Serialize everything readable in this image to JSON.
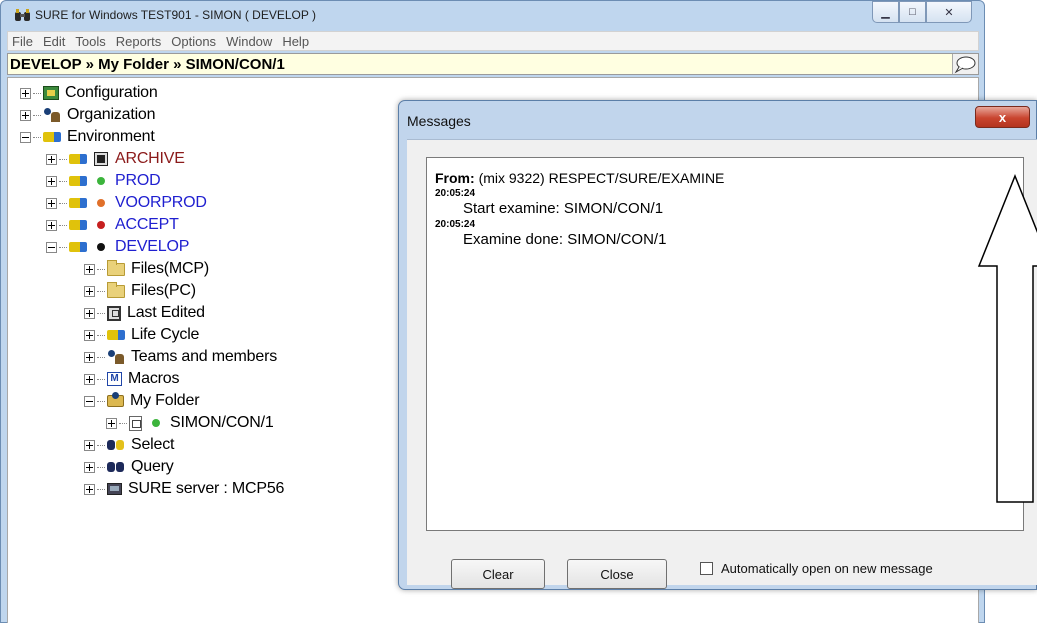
{
  "window": {
    "title": "SURE for Windows TEST901 - SIMON ( DEVELOP )",
    "minimize_symbol": "▁",
    "maximize_symbol": "□",
    "close_symbol": "✕"
  },
  "menu": [
    "File",
    "Edit",
    "Tools",
    "Reports",
    "Options",
    "Window",
    "Help"
  ],
  "path": "DEVELOP » My Folder » SIMON/CON/1",
  "tree": {
    "configuration": "Configuration",
    "organization": "Organization",
    "environment": "Environment",
    "archive": "ARCHIVE",
    "prod": "PROD",
    "voorprod": "VOORPROD",
    "accept": "ACCEPT",
    "develop": "DEVELOP",
    "files_mcp": "Files(MCP)",
    "files_pc": "Files(PC)",
    "last_edited": "Last Edited",
    "life_cycle": "Life Cycle",
    "teams": "Teams and members",
    "macros": "Macros",
    "my_folder": "My Folder",
    "simon_con": "SIMON/CON/1",
    "select": "Select",
    "query": "Query",
    "sure_server": "SURE server : MCP56"
  },
  "status_colors": {
    "prod": "#3cb43c",
    "voorprod": "#e0702a",
    "accept": "#c62020",
    "develop": "#111111",
    "simon_con": "#3cb43c"
  },
  "dialog": {
    "title": "Messages",
    "close_label": "x",
    "from_label": "From:",
    "from_value": "(mix 9322) RESPECT/SURE/EXAMINE",
    "time1": "20:05:24",
    "line1": "Start examine: SIMON/CON/1",
    "time2": "20:05:24",
    "line2": "Examine done: SIMON/CON/1",
    "clear_label": "Clear",
    "close_button_label": "Close",
    "auto_open_label": "Automatically open on new message",
    "auto_open_checked": false
  }
}
